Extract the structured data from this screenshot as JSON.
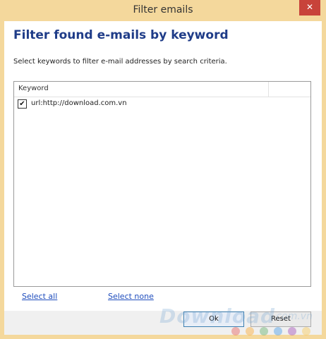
{
  "window": {
    "title": "Filter emails",
    "close_glyph": "✕",
    "frame_color": "#f4d89c",
    "close_color": "#c8433a"
  },
  "content": {
    "heading": "Filter found e-mails by keyword",
    "description": "Select keywords to filter e-mail addresses by search criteria."
  },
  "list": {
    "column_header": "Keyword",
    "rows": [
      {
        "label": "url:http://download.com.vn",
        "checked": true
      }
    ]
  },
  "links": {
    "select_all": "Select all",
    "select_none": "Select none"
  },
  "buttons": {
    "ok": "Ok",
    "reset": "Reset"
  },
  "watermark": {
    "brand": "Download",
    "suffix": ".com.vn",
    "dot_colors": [
      "#e53935",
      "#ff9800",
      "#43a047",
      "#1e88e5",
      "#8e24aa",
      "#fbc02d"
    ]
  }
}
